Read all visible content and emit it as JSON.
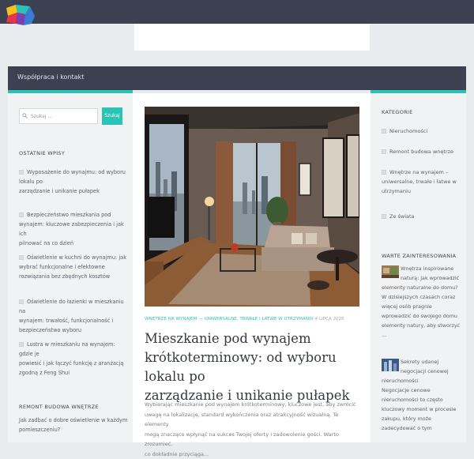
{
  "header": {
    "site_name": ""
  },
  "nav": {
    "items": [
      "Współpraca i kontakt"
    ]
  },
  "search": {
    "placeholder": "Szukaj ...",
    "button_label": "Szukaj"
  },
  "left_sidebar": {
    "recent_title": "OSTATNIE WPISY",
    "recent_posts": [
      [
        "Oświetlenie kuchni do wynajmu: jak",
        "wybrać funkcjonalne i efektowne",
        "rozwiązania bez zbędnych kosztów"
      ]
    ],
    "recent_posts_all": [
      {
        "lines": [
          "Wyposażenie do wynajmu: od wyboru lokalu po",
          "zarządzanie i unikanie pułapek"
        ]
      },
      {
        "lines": [
          "Bezpieczeństwo mieszkania pod",
          "wynajem: kluczowe zabezpieczenia i jak ich",
          "pilnować na co dzień"
        ]
      },
      {
        "lines": [
          "Oświetlenie w kuchni do wynajmu: jak",
          "wybrać funkcjonalne i efektowne",
          "rozwiązania bez zbędnych kosztów"
        ]
      },
      {
        "lines": [
          "Oświetlenie do łazienki w mieszkaniu na",
          "wynajem: trwałość, funkcjonalność i",
          "bezpieczeństwo wyboru"
        ]
      },
      {
        "lines": [
          "Lustra w mieszkaniu na wynajem: gdzie je",
          "powiesić i jak łączyć funkcję z aranżacją",
          "zgodną z Feng Shui"
        ]
      }
    ],
    "remont_title": "REMONT BUDOWA WNĘTRZE",
    "remont_lines": [
      "Jak zadbać o dobre oświetlenie w każdym",
      "pomieszczeniu?"
    ]
  },
  "main": {
    "category": "WNĘTRZE NA WYNAJEM",
    "separator": " — ",
    "category2": "UNIWERSALNE, TRWAŁE I ŁATWE W UTRZYMANIU",
    "date": "4 LIPCA 2026",
    "title_lines": [
      "Mieszkanie pod wynajem",
      "krótkoterminowy: od wyboru lokalu po",
      "zarządzanie i unikanie pułapek"
    ],
    "excerpt_lines": [
      "Wybierając mieszkanie pod wynajem krótkoterminowy, kluczowe jest, aby zwrócić",
      "uwagę na lokalizację, standard wykończenia oraz atrakcyjność wizualną. Te elementy",
      "mogą znacząco wpłynąć na sukces Twojej oferty i zadowolenie gości. Warto zrozumieć,",
      "co dokładnie przyciąga..."
    ]
  },
  "right_sidebar": {
    "categories_title": "KATEGORIE",
    "categories": [
      [
        "Nieruchomości"
      ],
      [
        "Remont budowa wnętrze"
      ],
      [
        "Wnętrze na wynajem –",
        "uniwersalne, trwałe i łatwe w",
        "utrzymaniu"
      ],
      [
        "Ze świata"
      ]
    ],
    "featured_title": "WARTE ZAINTERESOWANIA",
    "featured": [
      {
        "lines": [
          "Wnętrza inspirowane",
          "naturą: jak wprowadzić",
          "elementy naturalne do domu?",
          "W dzisiejszych czasach coraz",
          "więcej osób pragnie",
          "wprowadzić do swojego domu",
          "elementy natury, aby stworzyć",
          "..."
        ]
      },
      {
        "lines": [
          "Sekrety udanej",
          "negocjacji cenowej",
          "nieruchomości",
          "Negocjacje cenowe",
          "nieruchomości to często",
          "kluczowy moment w procesie",
          "zakupu, który może",
          "zadecydować o tym"
        ]
      }
    ]
  },
  "colors": {
    "dark": "#3b4150",
    "accent": "#2bc3b5",
    "sidebar_bg": "#f1f2f4"
  },
  "icons": {
    "search": "search-icon",
    "bullet": "square-bullet-icon"
  }
}
